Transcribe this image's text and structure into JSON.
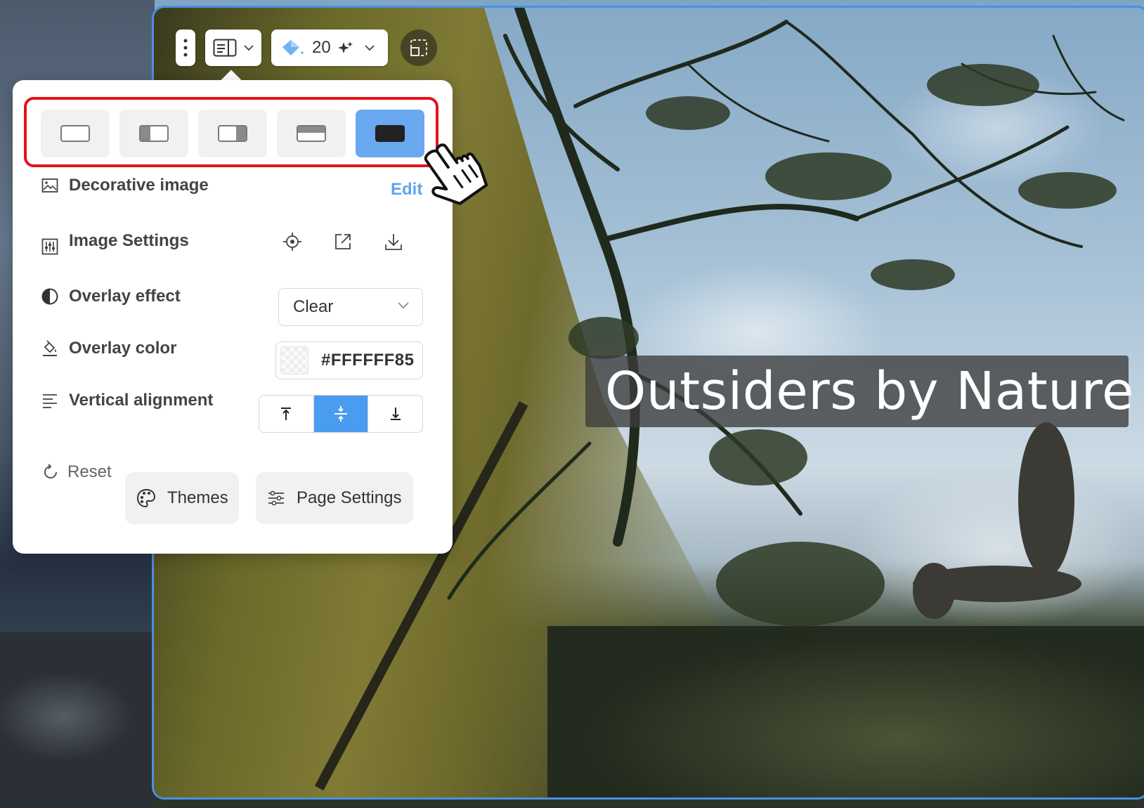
{
  "toolbar": {
    "more_icon": "vertical-dots-icon",
    "layout_icon": "layout-icon",
    "credits_value": "20",
    "credits_icon": "sparkle-gem-icon",
    "crop_icon": "crop-frame-icon"
  },
  "panel": {
    "layout_options": [
      {
        "name": "full-width-frame",
        "active": false
      },
      {
        "name": "image-left",
        "active": false
      },
      {
        "name": "image-right",
        "active": false
      },
      {
        "name": "image-top-banner",
        "active": false
      },
      {
        "name": "full-background",
        "active": true
      }
    ],
    "decorative_label": "Decorative image",
    "edit_label": "Edit",
    "image_settings_label": "Image Settings",
    "overlay_effect_label": "Overlay effect",
    "overlay_effect_value": "Clear",
    "overlay_color_label": "Overlay color",
    "overlay_color_value": "#FFFFFF85",
    "vertical_alignment_label": "Vertical alignment",
    "vertical_alignment_options": [
      "top",
      "middle",
      "bottom"
    ],
    "vertical_alignment_selected": "middle",
    "reset_label": "Reset",
    "themes_label": "Themes",
    "page_settings_label": "Page Settings"
  },
  "canvas": {
    "headline": "Outsiders by Nature"
  },
  "colors": {
    "accent": "#4a9cf0",
    "highlight": "#e3121b",
    "edit_link": "#5fa4ee"
  }
}
